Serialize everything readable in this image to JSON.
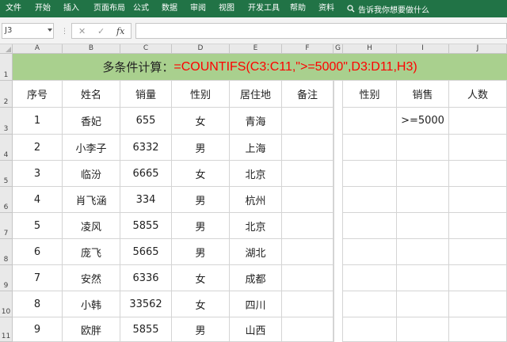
{
  "ribbon": {
    "tabs": [
      "文件",
      "开始",
      "插入",
      "页面布局",
      "公式",
      "数据",
      "审阅",
      "视图",
      "开发工具",
      "帮助",
      "资料"
    ],
    "tell_me": "告诉我你想要做什么"
  },
  "formula_bar": {
    "name_box": "J3",
    "cancel_symbol": "✕",
    "enter_symbol": "✓",
    "fx_label": "fx",
    "formula": ""
  },
  "columns": [
    "A",
    "B",
    "C",
    "D",
    "E",
    "F",
    "G",
    "H",
    "I",
    "J"
  ],
  "rows": [
    "1",
    "2",
    "3",
    "4",
    "5",
    "6",
    "7",
    "8",
    "9",
    "10",
    "11"
  ],
  "banner": {
    "label": "多条件计算：",
    "formula": "=COUNTIFS(C3:C11,\">=5000\",D3:D11,H3)"
  },
  "table": {
    "headers": [
      "序号",
      "姓名",
      "销量",
      "性别",
      "居住地",
      "备注"
    ],
    "rows": [
      [
        "1",
        "香妃",
        "655",
        "女",
        "青海",
        ""
      ],
      [
        "2",
        "小李子",
        "6332",
        "男",
        "上海",
        ""
      ],
      [
        "3",
        "临汾",
        "6665",
        "女",
        "北京",
        ""
      ],
      [
        "4",
        "肖飞涵",
        "334",
        "男",
        "杭州",
        ""
      ],
      [
        "5",
        "凌风",
        "5855",
        "男",
        "北京",
        ""
      ],
      [
        "6",
        "庞飞",
        "5665",
        "男",
        "湖北",
        ""
      ],
      [
        "7",
        "安然",
        "6336",
        "女",
        "成都",
        ""
      ],
      [
        "8",
        "小韩",
        "33562",
        "女",
        "四川",
        ""
      ],
      [
        "9",
        "欧胖",
        "5855",
        "男",
        "山西",
        ""
      ]
    ]
  },
  "criteria": {
    "headers": [
      "性别",
      "销售",
      "人数"
    ],
    "values": [
      "",
      ">=5000",
      ""
    ]
  },
  "colors": {
    "ribbon": "#217346",
    "banner_fill": "#a9d08e",
    "formula_text": "#ff0000"
  }
}
